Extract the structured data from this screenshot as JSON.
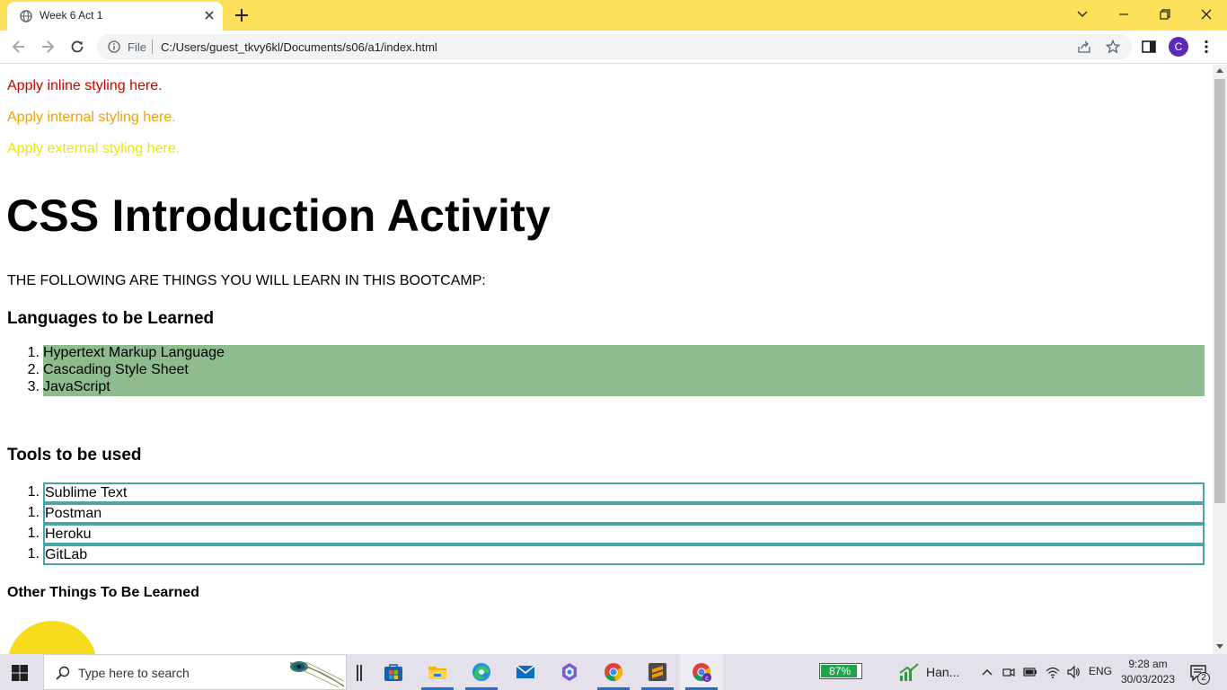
{
  "browser": {
    "tab_title": "Week 6 Act 1",
    "address": {
      "scheme_label": "File",
      "url": "C:/Users/guest_tkvy6kl/Documents/s06/a1/index.html"
    },
    "profile_initial": "C"
  },
  "page": {
    "inline_text": "Apply inline styling here.",
    "internal_text": "Apply internal styling here.",
    "external_text": "Apply external styling here.",
    "heading": "CSS Introduction Activity",
    "intro": "THE FOLLOWING ARE THINGS YOU WILL LEARN IN THIS BOOTCAMP:",
    "languages": {
      "title": "Languages to be Learned",
      "items": [
        {
          "num": "1.",
          "label": "Hypertext Markup Language"
        },
        {
          "num": "2.",
          "label": "Cascading Style Sheet"
        },
        {
          "num": "3.",
          "label": "JavaScript"
        }
      ]
    },
    "tools": {
      "title": "Tools to be used",
      "items": [
        {
          "num": "1.",
          "label": "Sublime Text"
        },
        {
          "num": "1.",
          "label": "Postman"
        },
        {
          "num": "1.",
          "label": "Heroku"
        },
        {
          "num": "1.",
          "label": "GitLab"
        }
      ]
    },
    "other_title": "Other Things To Be Learned"
  },
  "taskbar": {
    "search_placeholder": "Type here to search",
    "battery_percent": "87%",
    "stock_label": "Han...",
    "language": "ENG",
    "time": "9:28 am",
    "date": "30/03/2023",
    "notification_count": "2"
  },
  "colors": {
    "titlebar": "#ffe05a",
    "inline_text": "#cc0000",
    "internal_text": "#f2a200",
    "external_text": "#e8e800",
    "language_list_bg": "#8fbc8f",
    "tool_border": "#4aa6a6",
    "circle": "#f7dc1c",
    "profile": "#5b2bb5"
  },
  "icons": [
    "globe-icon",
    "close-icon",
    "plus-icon",
    "chevron-down-icon",
    "minimize-icon",
    "restore-icon",
    "back-icon",
    "forward-icon",
    "reload-icon",
    "info-icon",
    "share-icon",
    "star-icon",
    "side-panel-icon",
    "windows-start-icon",
    "search-icon",
    "feather-icon",
    "task-view-icon",
    "microsoft-store-icon",
    "file-explorer-icon",
    "edge-icon",
    "mail-icon",
    "copilot-icon",
    "chrome-icon",
    "sublime-icon",
    "chrome-profile-icon",
    "stocks-icon",
    "chevron-up-icon",
    "meet-icon",
    "battery-icon",
    "wifi-icon",
    "speaker-icon",
    "notification-icon"
  ]
}
